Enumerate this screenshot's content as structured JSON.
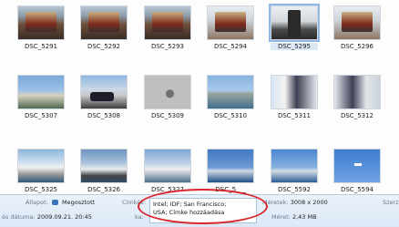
{
  "thumbnails": [
    [
      "DSC_5291",
      "DSC_5292",
      "DSC_5293",
      "DSC_5294",
      "DSC_5295",
      "DSC_5296"
    ],
    [
      "DSC_5307",
      "DSC_5308",
      "DSC_5309",
      "DSC_5310",
      "DSC_5311",
      "DSC_5312"
    ],
    [
      "DSC_5325",
      "DSC_5326",
      "DSC_5327",
      "DSC_5___",
      "DSC_5592",
      "DSC_5594"
    ]
  ],
  "details": {
    "state_label": "Állapot:",
    "state_value": "Megosztott",
    "date_label": "és dátuma:",
    "date_value": "2009.09.21. 20:45",
    "tags_label": "Címkék:",
    "tags_line1": "Intel; IDF; San Francisco;",
    "tags_line2": "USA; Címke hozzáadása",
    "rating_label": "ka:",
    "dim_label": "Méretek:",
    "dim_value": "3008 x 2000",
    "size_label": "Méret:",
    "size_value": "2,43 MB",
    "author_label": "Szerz"
  },
  "colors": {
    "highlight_oval": "#d8262c"
  }
}
